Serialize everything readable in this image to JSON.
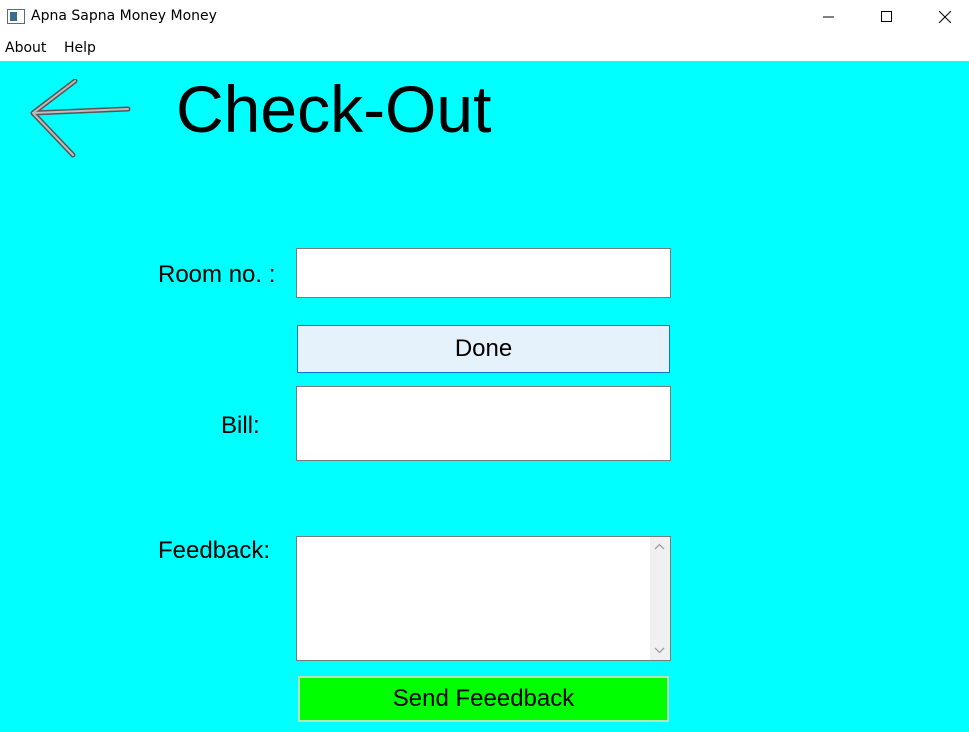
{
  "window": {
    "title": "Apna Sapna Money Money",
    "controls": [
      "minimize-icon",
      "maximize-icon",
      "close-icon"
    ]
  },
  "menu": {
    "items": [
      {
        "label": "About"
      },
      {
        "label": "Help"
      }
    ]
  },
  "page": {
    "title": "Check-Out",
    "back_icon": "back-arrow-icon",
    "background_color": "#00ffff"
  },
  "form": {
    "room": {
      "label": "Room no. :",
      "value": ""
    },
    "done_button": {
      "label": "Done",
      "color": "#e5f1fb"
    },
    "bill": {
      "label": "Bill:",
      "value": ""
    },
    "feedback": {
      "label": "Feedback:",
      "value": ""
    },
    "send_button": {
      "label": "Send Feeedback",
      "color": "#00ff00"
    }
  }
}
